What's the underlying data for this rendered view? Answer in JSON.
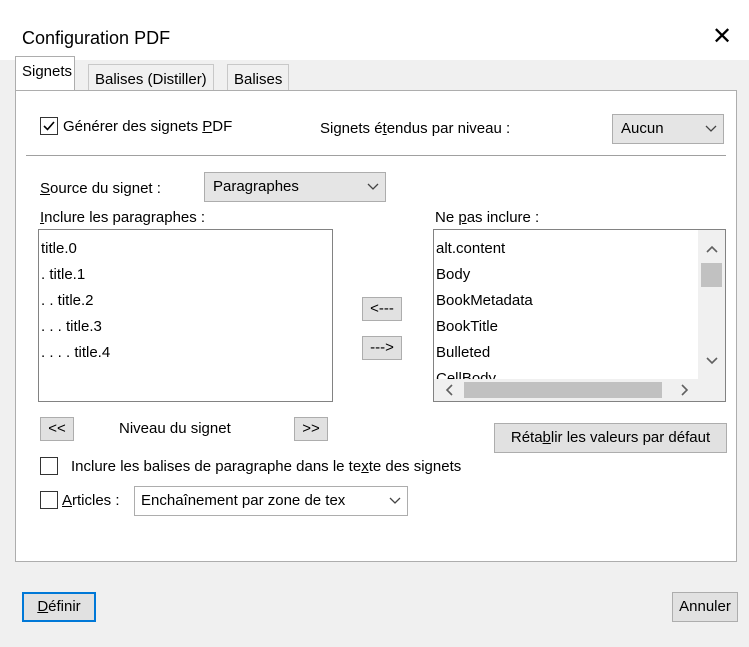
{
  "dialog": {
    "title": "Configuration PDF",
    "close_glyph": "✕"
  },
  "tabs": [
    {
      "label": "Signets",
      "active": true
    },
    {
      "label": "Balises (Distiller)",
      "active": false
    },
    {
      "label": "Balises",
      "active": false
    }
  ],
  "bookmarks": {
    "generate_checkbox": {
      "checked": true,
      "pre": "Générer des signets ",
      "accel": "P",
      "post": "DF"
    },
    "expanded_label": {
      "pre": "Signets é",
      "accel": "t",
      "post": "endus par niveau :"
    },
    "expanded_value": "Aucun",
    "source_label": {
      "accel": "S",
      "post": "ource du signet :"
    },
    "source_value": "Paragraphes",
    "include_label": {
      "accel": "I",
      "post": "nclure les paragraphes :"
    },
    "exclude_label": {
      "pre": "Ne ",
      "accel": "p",
      "post": "as inclure :"
    },
    "include_items": [
      "title.0",
      ". title.1",
      ". . title.2",
      ". . . title.3",
      ". . . . title.4"
    ],
    "exclude_items": [
      "alt.content",
      "Body",
      "BookMetadata",
      "BookTitle",
      "Bulleted",
      "CellBody"
    ],
    "move_left": "<---",
    "move_right": "--->",
    "level_down": "<<",
    "level_up": ">>",
    "level_label": "Niveau du signet",
    "reset_button": {
      "pre": "Réta",
      "accel": "b",
      "post": "lir les valeurs par défaut"
    },
    "include_tags_checkbox": {
      "checked": false,
      "pre": "Inclure les balises de paragraphe dans le te",
      "accel": "x",
      "post": "te des signets"
    },
    "articles_checkbox": {
      "checked": false,
      "accel": "A",
      "post": "rticles :"
    },
    "articles_value": "Enchaînement par zone de tex"
  },
  "buttons": {
    "define": {
      "accel": "D",
      "post": "éfinir"
    },
    "cancel": "Annuler"
  }
}
